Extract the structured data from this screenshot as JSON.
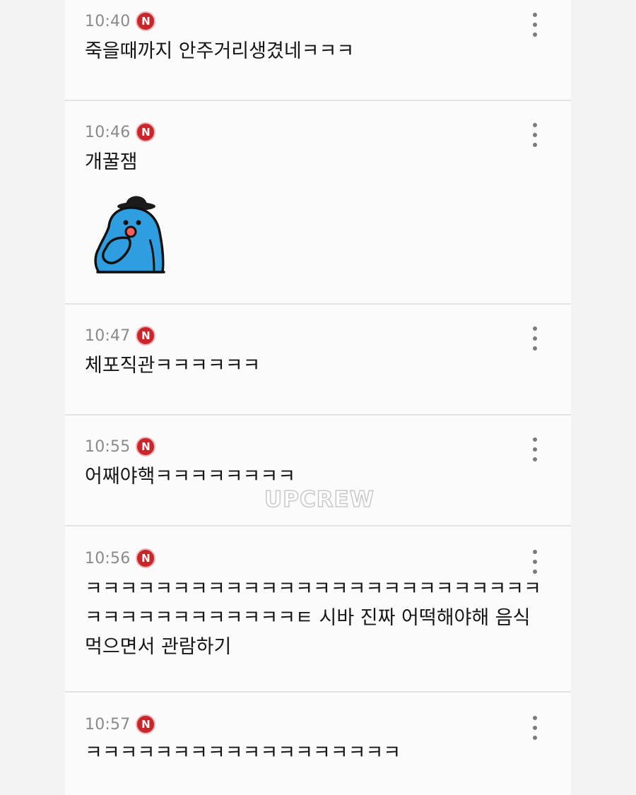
{
  "comments": [
    {
      "time": "10:40",
      "badge": "N",
      "text": "죽을때까지 안주거리생겼네ㅋㅋㅋ"
    },
    {
      "time": "10:46",
      "badge": "N",
      "text": "개꿀잼",
      "sticker": "blue-character-thinking-with-bowler-hat"
    },
    {
      "time": "10:47",
      "badge": "N",
      "text": "체포직관ㅋㅋㅋㅋㅋㅋ"
    },
    {
      "time": "10:55",
      "badge": "N",
      "text": "어째야핵ㅋㅋㅋㅋㅋㅋㅋㅋ"
    },
    {
      "time": "10:56",
      "badge": "N",
      "text": "ㅋㅋㅋㅋㅋㅋㅋㅋㅋㅋㅋㅋㅋㅋㅋㅋㅋㅋㅋㅋㅋㅋㅋㅋㅋㅋ ㅋㅋㅋㅋㅋㅋㅋㅋㅋㅋㅋㅋㅌ 시바 진짜 어떡해야해 음식 먹으면서 관람하기"
    },
    {
      "time": "10:57",
      "badge": "N",
      "text": "ㅋㅋㅋㅋㅋㅋㅋㅋㅋㅋㅋㅋㅋㅋㅋㅋㅋㅋ"
    }
  ],
  "watermark": "UPCREW",
  "icons": {
    "more": "more-vertical-icon",
    "badge": "new-badge-icon"
  },
  "colors": {
    "badge": "#c9262c",
    "time": "#8a8a8a",
    "text": "#161616",
    "sticker_blue": "#2f9ee0"
  }
}
